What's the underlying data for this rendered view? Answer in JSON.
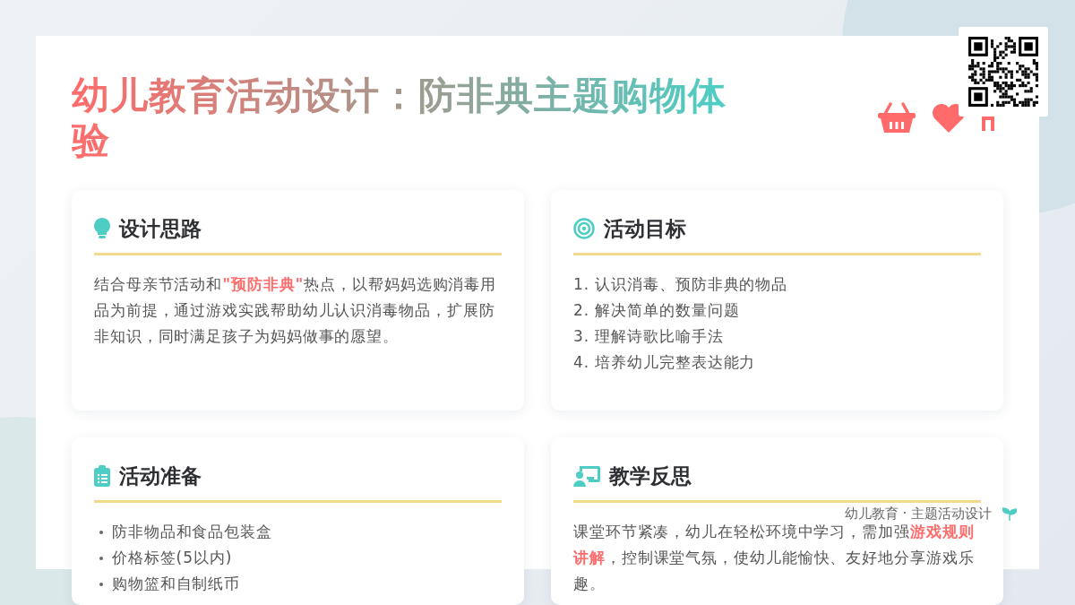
{
  "title": "幼儿教育活动设计：防非典主题购物体验",
  "cards": [
    {
      "heading": "设计思路",
      "kind": "paragraph",
      "text": "结合母亲节活动和**\"预防非典\"**热点，以帮妈妈选购消毒用品为前提，通过游戏实践帮助幼儿认识消毒物品，扩展防非知识，同时满足孩子为妈妈做事的愿望。"
    },
    {
      "heading": "活动目标",
      "kind": "lines",
      "items": [
        "1. 认识消毒、预防非典的物品",
        "2. 解决简单的数量问题",
        "3. 理解诗歌比喻手法",
        "4. 培养幼儿完整表达能力"
      ]
    },
    {
      "heading": "活动准备",
      "kind": "bullets",
      "items": [
        "防非物品和食品包装盒",
        "价格标签(5以内)",
        "购物篮和自制纸币"
      ]
    },
    {
      "heading": "教学反思",
      "kind": "paragraph",
      "text": "课堂环节紧凑，幼儿在轻松环境中学习，需加强**游戏规则讲解**，控制课堂气氛，使幼儿能愉快、友好地分享游戏乐趣。"
    }
  ],
  "footer": "幼儿教育 · 主题活动设计"
}
